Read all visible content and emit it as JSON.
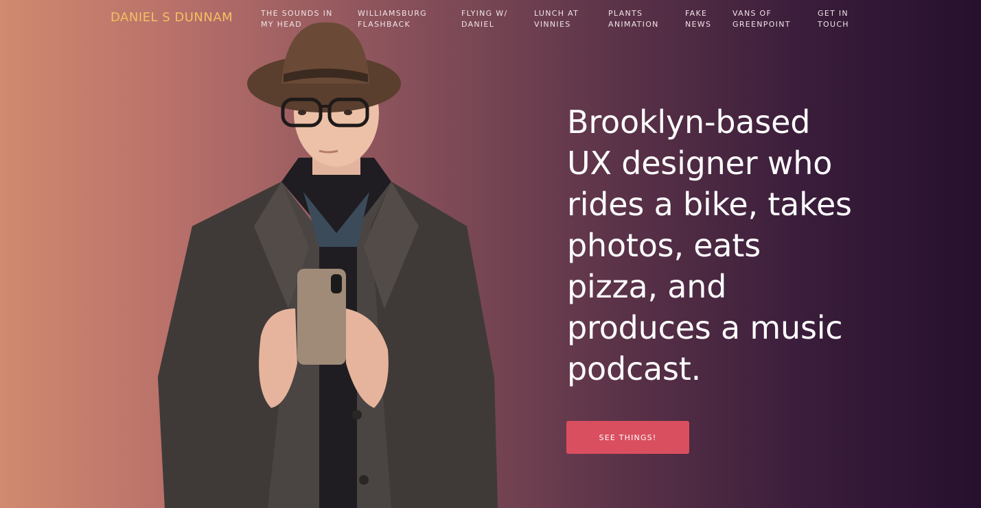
{
  "brand": "DANIEL S DUNNAM",
  "nav": [
    {
      "line1": "THE SOUNDS IN",
      "line2": "MY HEAD"
    },
    {
      "line1": "WILLIAMSBURG",
      "line2": "FLASHBACK"
    },
    {
      "line1": "FLYING W/",
      "line2": "DANIEL"
    },
    {
      "line1": "LUNCH AT",
      "line2": "VINNIES"
    },
    {
      "line1": "PLANTS",
      "line2": "ANIMATION"
    },
    {
      "line1": "FAKE",
      "line2": "NEWS"
    },
    {
      "line1": "VANS OF",
      "line2": "GREENPOINT"
    },
    {
      "line1": "GET IN",
      "line2": "TOUCH"
    }
  ],
  "hero": {
    "lines": [
      "Brooklyn-based",
      "UX designer who",
      "rides a bike, takes",
      "photos, eats",
      "pizza, and",
      "produces a music",
      "podcast."
    ],
    "cta_label": "SEE THINGS!"
  },
  "colors": {
    "brand": "#f5c062",
    "cta": "#d94f5f",
    "gradient_start": "#d08a6e",
    "gradient_end": "#25102e"
  }
}
